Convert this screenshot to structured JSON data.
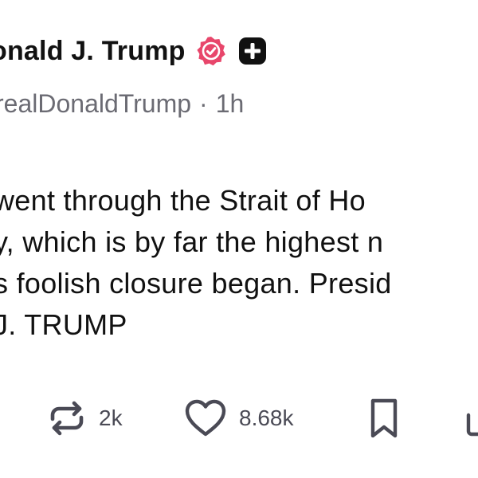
{
  "author": {
    "display_name": "onald J. Trump",
    "handle": "realDonaldTrump",
    "separator": "·",
    "time_ago": "1h"
  },
  "body_lines": [
    " went through the Strait of Ho",
    "y, which is by far the highest n",
    "s foolish closure began. Presid",
    " J. TRUMP"
  ],
  "actions": {
    "repost_count": "2k",
    "like_count": "8.68k"
  },
  "colors": {
    "verified_badge": "#e8466b",
    "plus_badge": "#111111",
    "secondary_text": "#6b6b73",
    "icon": "#4a4a55"
  },
  "icons": {
    "verified": "verified-badge-icon",
    "plus": "plus-badge-icon",
    "repost": "repost-icon",
    "like": "heart-icon",
    "save": "bookmark-icon",
    "share": "share-icon"
  }
}
